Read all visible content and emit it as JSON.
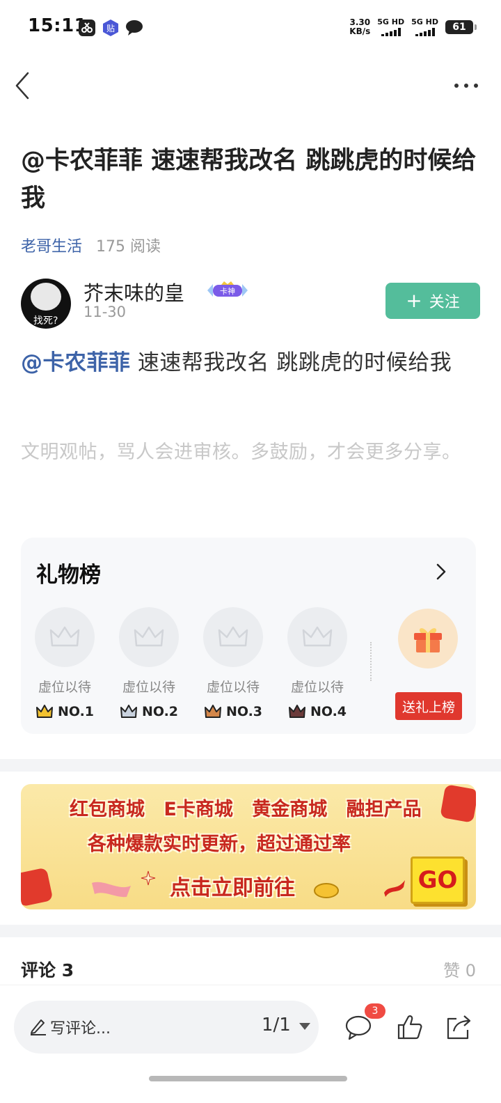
{
  "status_bar": {
    "time": "15:11",
    "net_speed_value": "3.30",
    "net_speed_unit": "KB/s",
    "sim1_label": "5G HD",
    "sim2_label": "5G HD",
    "battery": "61",
    "icons": [
      "scissor-app-icon",
      "tieba-app-icon",
      "message-bubble-icon"
    ]
  },
  "nav": {
    "back_icon": "chevron-left-icon",
    "more_icon": "more-dots-icon"
  },
  "post": {
    "title": "@卡农菲菲 速速帮我改名 跳跳虎的时候给我",
    "circle": "老哥生活",
    "read_count": "175 阅读",
    "author": {
      "name": "芥末味的皇",
      "badge_text": "卡神",
      "date": "11-30",
      "avatar_caption": "找死?"
    },
    "follow_label": "关注",
    "body_mention": "@卡农菲菲",
    "body_text": " 速速帮我改名  跳跳虎的时候给我",
    "hint": "文明观帖，骂人会进审核。多鼓励，才会更多分享。"
  },
  "gift_board": {
    "title": "礼物榜",
    "slots": [
      {
        "placeholder": "虚位以待",
        "rank": "NO.1",
        "crown_color": "#f2c230"
      },
      {
        "placeholder": "虚位以待",
        "rank": "NO.2",
        "crown_color": "#9aa7b8"
      },
      {
        "placeholder": "虚位以待",
        "rank": "NO.3",
        "crown_color": "#d4874a"
      },
      {
        "placeholder": "虚位以待",
        "rank": "NO.4",
        "crown_color": "#6b3a3a"
      }
    ],
    "send_label": "送礼上榜"
  },
  "banner": {
    "line1": "红包商城 E卡商城 黄金商城 融担产品",
    "line2": "各种爆款实时更新，超过通过率",
    "line3": "点击立即前往",
    "go_label": "GO"
  },
  "comments": {
    "title": "评论 3",
    "likes": "赞 0"
  },
  "bottom_bar": {
    "placeholder": "写评论...",
    "pager": "1/1",
    "comment_badge": "3"
  },
  "colors": {
    "accent_blue": "#3d63a8",
    "follow_green": "#54bd9b",
    "gift_red": "#e0382e"
  }
}
